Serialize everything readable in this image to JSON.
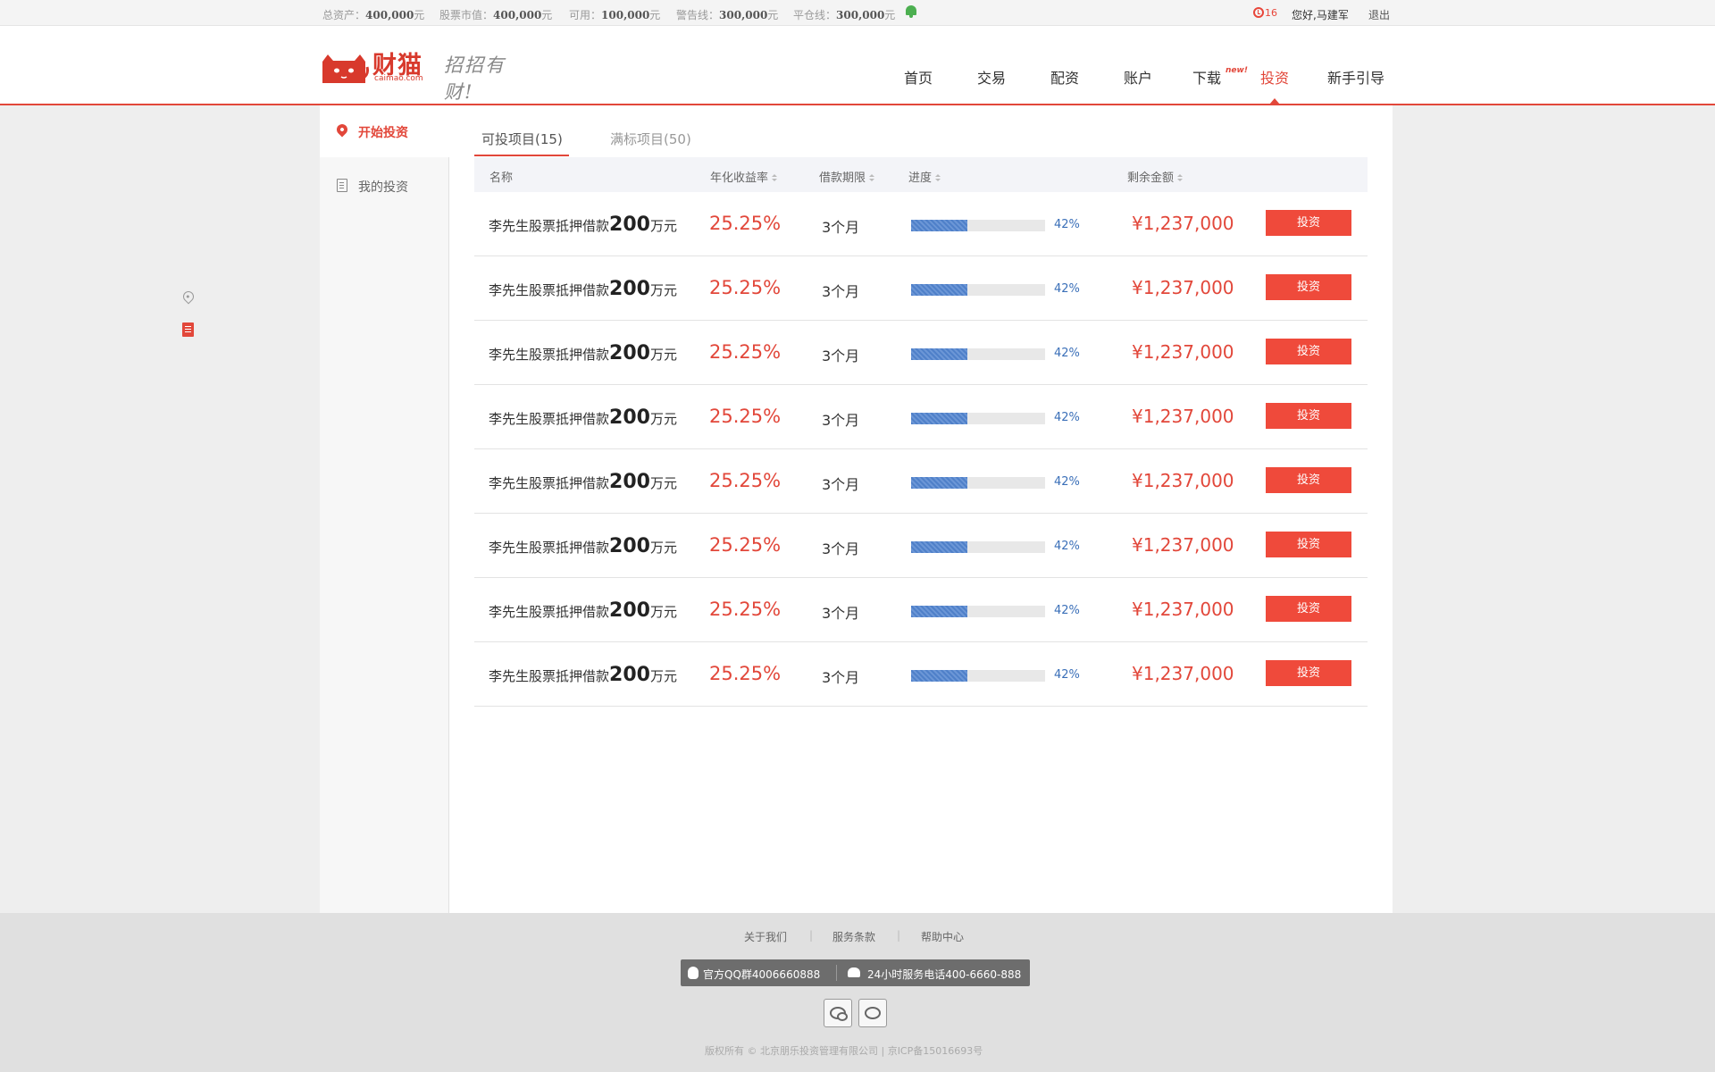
{
  "topbar": {
    "total_assets": {
      "label": "总资产：",
      "value": "400,000",
      "unit": "元"
    },
    "stock_value": {
      "label": "股票市值：",
      "value": "400,000",
      "unit": "元"
    },
    "available": {
      "label": "可用：",
      "value": "100,000",
      "unit": "元"
    },
    "warning_line": {
      "label": "警告线：",
      "value": "300,000",
      "unit": "元"
    },
    "liquidation_line": {
      "label": "平仓线：",
      "value": "300,000",
      "unit": "元"
    },
    "message_count": "16",
    "greeting": "您好,马建军",
    "logout": "退出"
  },
  "header": {
    "logo_text": "财猫",
    "logo_domain": "caimao.com",
    "slogan": "招招有财!",
    "nav": [
      "首页",
      "交易",
      "配资",
      "账户",
      "下载",
      "投资",
      "新手引导"
    ],
    "nav_badge": "new!",
    "active_nav": "投资"
  },
  "sidebar": {
    "start_invest": "开始投资",
    "my_invest": "我的投资"
  },
  "tabs": {
    "available": "可投项目(15)",
    "full": "满标项目(50)"
  },
  "table": {
    "headers": {
      "name": "名称",
      "rate": "年化收益率",
      "term": "借款期限",
      "progress": "进度",
      "remaining": "剩余金额"
    },
    "rows": [
      {
        "name": "李先生股票抵押借款",
        "amount": "200",
        "amount_unit": "万元",
        "rate": "25.25%",
        "term": "3个月",
        "progress": 42,
        "progress_text": "42%",
        "remaining": "¥1,237,000",
        "action": "投资"
      },
      {
        "name": "李先生股票抵押借款",
        "amount": "200",
        "amount_unit": "万元",
        "rate": "25.25%",
        "term": "3个月",
        "progress": 42,
        "progress_text": "42%",
        "remaining": "¥1,237,000",
        "action": "投资"
      },
      {
        "name": "李先生股票抵押借款",
        "amount": "200",
        "amount_unit": "万元",
        "rate": "25.25%",
        "term": "3个月",
        "progress": 42,
        "progress_text": "42%",
        "remaining": "¥1,237,000",
        "action": "投资"
      },
      {
        "name": "李先生股票抵押借款",
        "amount": "200",
        "amount_unit": "万元",
        "rate": "25.25%",
        "term": "3个月",
        "progress": 42,
        "progress_text": "42%",
        "remaining": "¥1,237,000",
        "action": "投资"
      },
      {
        "name": "李先生股票抵押借款",
        "amount": "200",
        "amount_unit": "万元",
        "rate": "25.25%",
        "term": "3个月",
        "progress": 42,
        "progress_text": "42%",
        "remaining": "¥1,237,000",
        "action": "投资"
      },
      {
        "name": "李先生股票抵押借款",
        "amount": "200",
        "amount_unit": "万元",
        "rate": "25.25%",
        "term": "3个月",
        "progress": 42,
        "progress_text": "42%",
        "remaining": "¥1,237,000",
        "action": "投资"
      },
      {
        "name": "李先生股票抵押借款",
        "amount": "200",
        "amount_unit": "万元",
        "rate": "25.25%",
        "term": "3个月",
        "progress": 42,
        "progress_text": "42%",
        "remaining": "¥1,237,000",
        "action": "投资"
      },
      {
        "name": "李先生股票抵押借款",
        "amount": "200",
        "amount_unit": "万元",
        "rate": "25.25%",
        "term": "3个月",
        "progress": 42,
        "progress_text": "42%",
        "remaining": "¥1,237,000",
        "action": "投资"
      }
    ]
  },
  "footer": {
    "links": [
      "关于我们",
      "服务条款",
      "帮助中心"
    ],
    "qq": "官方QQ群4006660888",
    "phone": "24小时服务电话400-6660-888",
    "copyright": "版权所有 © 北京朋乐投资管理有限公司  |  京ICP备15016693号"
  },
  "colors": {
    "accent": "#e2473a",
    "progress": "#4f80c9",
    "button": "#ef4a3b"
  }
}
